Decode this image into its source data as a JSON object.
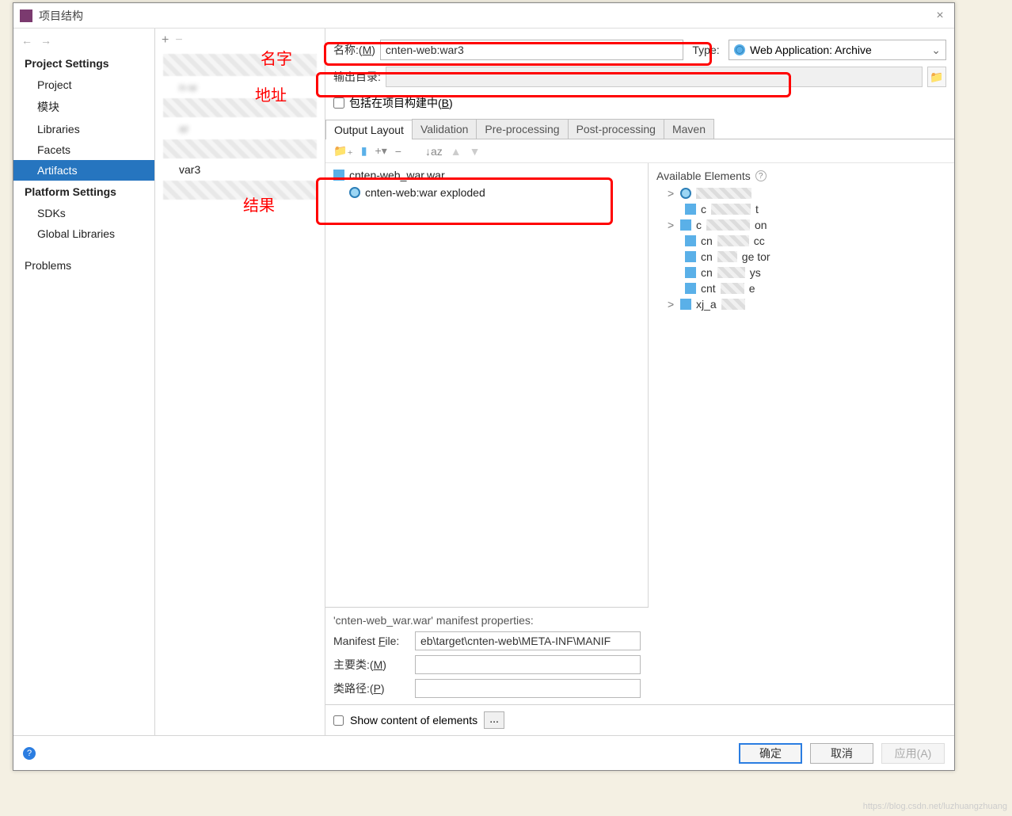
{
  "window": {
    "title": "项目结构"
  },
  "sidebar": {
    "project_settings_title": "Project Settings",
    "items_project": [
      "Project",
      "模块",
      "Libraries",
      "Facets",
      "Artifacts"
    ],
    "platform_settings_title": "Platform Settings",
    "items_platform": [
      "SDKs",
      "Global Libraries"
    ],
    "problems": "Problems"
  },
  "middle": {
    "items": [
      "n-w",
      "ar",
      "var3"
    ]
  },
  "form": {
    "name_label": "名称:(M)",
    "name_value": "cnten-web:war3",
    "type_label": "Type:",
    "type_value": "Web Application: Archive",
    "output_label": "输出目录:",
    "include_label": "包括在项目构建中(B)"
  },
  "tabs": [
    "Output Layout",
    "Validation",
    "Pre-processing",
    "Post-processing",
    "Maven"
  ],
  "layout_tree": {
    "archive": "cnten-web_war.war",
    "artifact": "cnten-web:war exploded"
  },
  "available": {
    "title": "Available Elements",
    "rows": [
      {
        "chev": ">",
        "text": "",
        "blur": true
      },
      {
        "chev": "",
        "prefix": "c",
        "text": "t",
        "blur": true
      },
      {
        "chev": ">",
        "prefix": "c",
        "text": "on",
        "blur": true
      },
      {
        "chev": "",
        "prefix": "cn",
        "text": "cc",
        "blur": true
      },
      {
        "chev": "",
        "prefix": "cn",
        "text": "ge        tor",
        "blur": true
      },
      {
        "chev": "",
        "prefix": "cn",
        "text": "ys",
        "blur": true
      },
      {
        "chev": "",
        "prefix": "cnt",
        "text": "e",
        "blur": true
      },
      {
        "chev": ">",
        "prefix": "xj_a",
        "text": "",
        "blur": true
      }
    ]
  },
  "manifest": {
    "title": "'cnten-web_war.war' manifest properties:",
    "file_label": "Manifest File:",
    "file_value": "eb\\target\\cnten-web\\META-INF\\MANIF",
    "main_class_label": "主要类:(M)",
    "classpath_label": "类路径:(P)"
  },
  "show_content": {
    "label": "Show content of elements"
  },
  "footer": {
    "ok": "确定",
    "cancel": "取消",
    "apply": "应用(A)"
  },
  "annotations": {
    "name": "名字",
    "addr": "地址",
    "result": "结果"
  },
  "watermark": "https://blog.csdn.net/luzhuangzhuang"
}
